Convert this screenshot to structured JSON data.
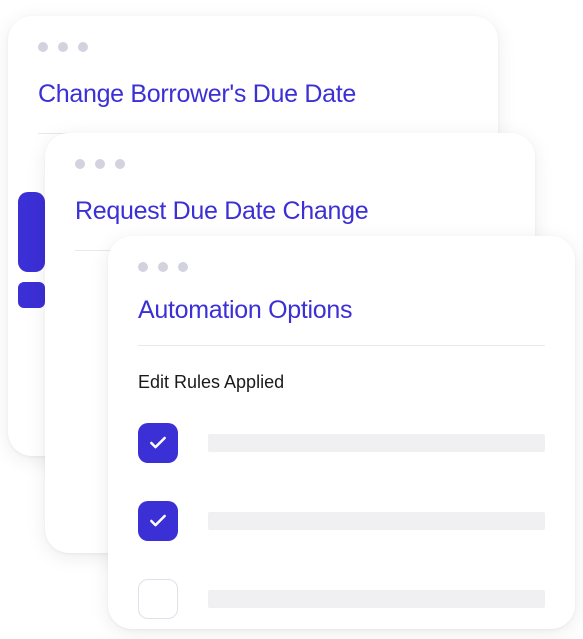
{
  "windows": {
    "w1": {
      "title": "Change Borrower's Due Date"
    },
    "w2": {
      "title": "Request Due Date Change"
    },
    "w3": {
      "title": "Automation Options",
      "section_label": "Edit Rules Applied"
    }
  }
}
